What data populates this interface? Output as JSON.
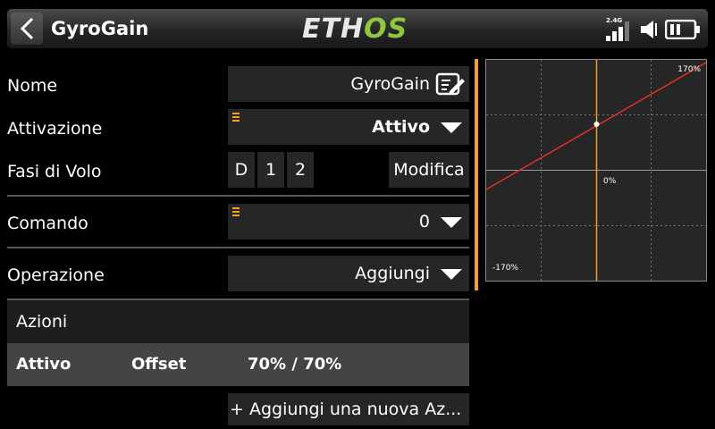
{
  "header": {
    "title": "GyroGain",
    "logo_main": "ETH",
    "logo_accent": "OS",
    "rf_band": "2.4G"
  },
  "form": {
    "name_label": "Nome",
    "name_value": "GyroGain",
    "activation_label": "Attivazione",
    "activation_value": "Attivo",
    "flight_modes_label": "Fasi di Volo",
    "flight_modes": [
      "D",
      "1",
      "2"
    ],
    "modify_label": "Modifica",
    "control_label": "Comando",
    "control_value": "0",
    "operation_label": "Operazione",
    "operation_value": "Aggiungi"
  },
  "actions": {
    "section_label": "Azioni",
    "rows": [
      {
        "state": "Attivo",
        "type": "Offset",
        "value": "70% / 70%"
      }
    ],
    "add_label": "+ Aggiungi una nuova Az..."
  },
  "graph": {
    "top_label": "170%",
    "center_label": "0%",
    "bottom_label": "-170%",
    "line_color": "#e0302a",
    "cursor_color": "#f0a030"
  },
  "colors": {
    "accent": "#f0a030",
    "field_bg": "#262626",
    "logo_green": "#8ec63f"
  }
}
